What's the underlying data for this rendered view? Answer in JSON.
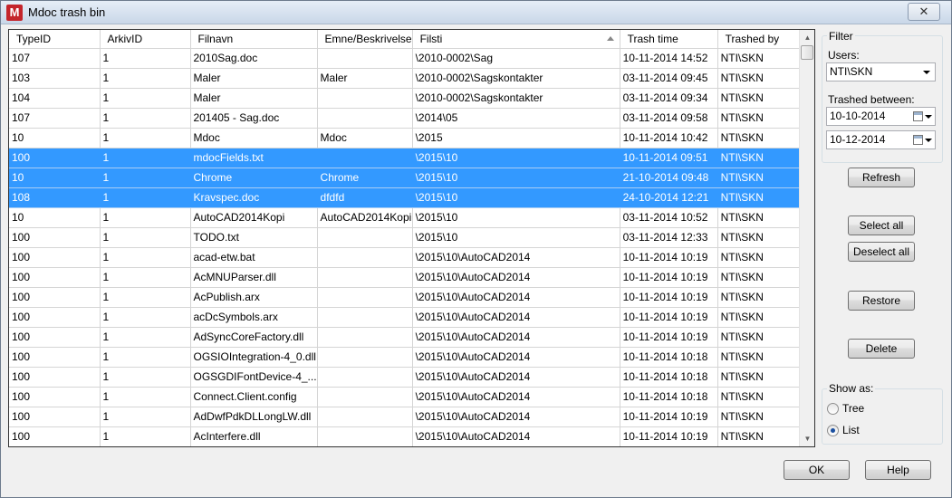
{
  "window": {
    "title": "Mdoc trash bin",
    "app_icon_letter": "M",
    "close_glyph": "✕"
  },
  "grid": {
    "columns": [
      "TypeID",
      "ArkivID",
      "Filnavn",
      "Emne/Beskrivelse",
      "Filsti",
      "Trash time",
      "Trashed by"
    ],
    "sorted_column": "Filsti",
    "rows": [
      {
        "cells": [
          "107",
          "1",
          "2010Sag.doc",
          "",
          "\\2010-0002\\Sag",
          "10-11-2014 14:52",
          "NTI\\SKN"
        ],
        "selected": false
      },
      {
        "cells": [
          "103",
          "1",
          "Maler",
          "Maler",
          "\\2010-0002\\Sagskontakter",
          "03-11-2014 09:45",
          "NTI\\SKN"
        ],
        "selected": false
      },
      {
        "cells": [
          "104",
          "1",
          "Maler",
          "",
          "\\2010-0002\\Sagskontakter",
          "03-11-2014 09:34",
          "NTI\\SKN"
        ],
        "selected": false
      },
      {
        "cells": [
          "107",
          "1",
          "201405 - Sag.doc",
          "",
          "\\2014\\05",
          "03-11-2014 09:58",
          "NTI\\SKN"
        ],
        "selected": false
      },
      {
        "cells": [
          "10",
          "1",
          "Mdoc",
          "Mdoc",
          "\\2015",
          "10-11-2014 10:42",
          "NTI\\SKN"
        ],
        "selected": false
      },
      {
        "cells": [
          "100",
          "1",
          "mdocFields.txt",
          "",
          "\\2015\\10",
          "10-11-2014 09:51",
          "NTI\\SKN"
        ],
        "selected": true
      },
      {
        "cells": [
          "10",
          "1",
          "Chrome",
          "Chrome",
          "\\2015\\10",
          "21-10-2014 09:48",
          "NTI\\SKN"
        ],
        "selected": true
      },
      {
        "cells": [
          "108",
          "1",
          "Kravspec.doc",
          "dfdfd",
          "\\2015\\10",
          "24-10-2014 12:21",
          "NTI\\SKN"
        ],
        "selected": true
      },
      {
        "cells": [
          "10",
          "1",
          "AutoCAD2014Kopi",
          "AutoCAD2014Kopi",
          "\\2015\\10",
          "03-11-2014 10:52",
          "NTI\\SKN"
        ],
        "selected": false
      },
      {
        "cells": [
          "100",
          "1",
          "TODO.txt",
          "",
          "\\2015\\10",
          "03-11-2014 12:33",
          "NTI\\SKN"
        ],
        "selected": false
      },
      {
        "cells": [
          "100",
          "1",
          "acad-etw.bat",
          "",
          "\\2015\\10\\AutoCAD2014",
          "10-11-2014 10:19",
          "NTI\\SKN"
        ],
        "selected": false
      },
      {
        "cells": [
          "100",
          "1",
          "AcMNUParser.dll",
          "",
          "\\2015\\10\\AutoCAD2014",
          "10-11-2014 10:19",
          "NTI\\SKN"
        ],
        "selected": false
      },
      {
        "cells": [
          "100",
          "1",
          "AcPublish.arx",
          "",
          "\\2015\\10\\AutoCAD2014",
          "10-11-2014 10:19",
          "NTI\\SKN"
        ],
        "selected": false
      },
      {
        "cells": [
          "100",
          "1",
          "acDcSymbols.arx",
          "",
          "\\2015\\10\\AutoCAD2014",
          "10-11-2014 10:19",
          "NTI\\SKN"
        ],
        "selected": false
      },
      {
        "cells": [
          "100",
          "1",
          "AdSyncCoreFactory.dll",
          "",
          "\\2015\\10\\AutoCAD2014",
          "10-11-2014 10:19",
          "NTI\\SKN"
        ],
        "selected": false
      },
      {
        "cells": [
          "100",
          "1",
          "OGSIOIntegration-4_0.dll",
          "",
          "\\2015\\10\\AutoCAD2014",
          "10-11-2014 10:18",
          "NTI\\SKN"
        ],
        "selected": false
      },
      {
        "cells": [
          "100",
          "1",
          "OGSGDIFontDevice-4_...",
          "",
          "\\2015\\10\\AutoCAD2014",
          "10-11-2014 10:18",
          "NTI\\SKN"
        ],
        "selected": false
      },
      {
        "cells": [
          "100",
          "1",
          "Connect.Client.config",
          "",
          "\\2015\\10\\AutoCAD2014",
          "10-11-2014 10:18",
          "NTI\\SKN"
        ],
        "selected": false
      },
      {
        "cells": [
          "100",
          "1",
          "AdDwfPdkDLLongLW.dll",
          "",
          "\\2015\\10\\AutoCAD2014",
          "10-11-2014 10:19",
          "NTI\\SKN"
        ],
        "selected": false
      },
      {
        "cells": [
          "100",
          "1",
          "AcInterfere.dll",
          "",
          "\\2015\\10\\AutoCAD2014",
          "10-11-2014 10:19",
          "NTI\\SKN"
        ],
        "selected": false
      }
    ]
  },
  "filter": {
    "group_label": "Filter",
    "users_label": "Users:",
    "users_value": "NTI\\SKN",
    "trashed_between_label": "Trashed between:",
    "date_from": "10-10-2014",
    "date_to": "10-12-2014"
  },
  "buttons": {
    "refresh": "Refresh",
    "select_all": "Select all",
    "deselect_all": "Deselect all",
    "restore": "Restore",
    "delete": "Delete",
    "ok": "OK",
    "help": "Help"
  },
  "show_as": {
    "group_label": "Show as:",
    "tree_label": "Tree",
    "list_label": "List",
    "selected": "List"
  },
  "colors": {
    "selection": "#3399ff",
    "title_icon": "#c4252b"
  }
}
